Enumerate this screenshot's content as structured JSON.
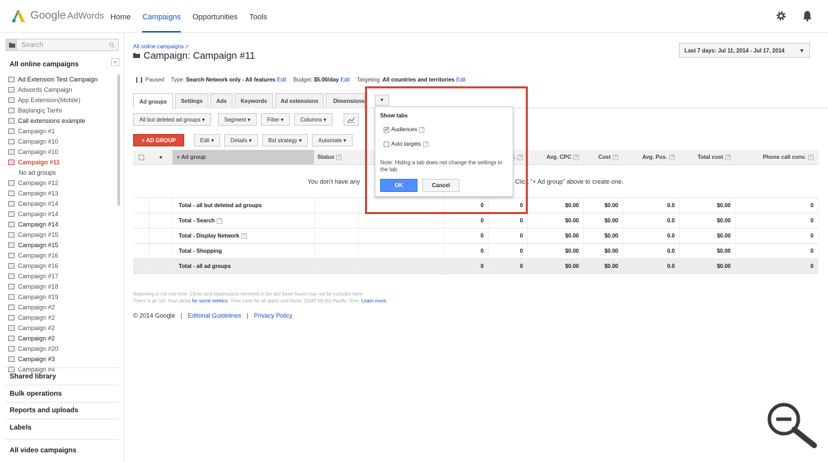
{
  "app": {
    "name": "Google AdWords",
    "name_main": "Google",
    "name_sub": "AdWords"
  },
  "topnav": [
    {
      "label": "Home",
      "active": false
    },
    {
      "label": "Campaigns",
      "active": true
    },
    {
      "label": "Opportunities",
      "active": false
    },
    {
      "label": "Tools",
      "active": false
    }
  ],
  "sidebar": {
    "search_placeholder": "Search",
    "all_campaigns_label": "All online campaigns",
    "campaigns": [
      {
        "label": "Ad Extension Test Campaign",
        "style": "bold"
      },
      {
        "label": "Adwords Campaign",
        "style": ""
      },
      {
        "label": "App Extension(Mobile)",
        "style": ""
      },
      {
        "label": "Başlangıç Tarihi",
        "style": ""
      },
      {
        "label": "Call extensions example",
        "style": "bold"
      },
      {
        "label": "Campaign #1",
        "style": ""
      },
      {
        "label": "Campaign #10",
        "style": ""
      },
      {
        "label": "Campaign #10",
        "style": ""
      },
      {
        "label": "Campaign #11",
        "style": "active"
      },
      {
        "label": "No ad groups",
        "style": "sub"
      },
      {
        "label": "Campaign #12",
        "style": ""
      },
      {
        "label": "Campaign #13",
        "style": ""
      },
      {
        "label": "Campaign #14",
        "style": ""
      },
      {
        "label": "Campaign #14",
        "style": ""
      },
      {
        "label": "Campaign #14",
        "style": "bold"
      },
      {
        "label": "Campaign #15",
        "style": ""
      },
      {
        "label": "Campaign #15",
        "style": "bold"
      },
      {
        "label": "Campaign #16",
        "style": ""
      },
      {
        "label": "Campaign #16",
        "style": ""
      },
      {
        "label": "Campaign #17",
        "style": ""
      },
      {
        "label": "Campaign #18",
        "style": ""
      },
      {
        "label": "Campaign #19",
        "style": ""
      },
      {
        "label": "Campaign #2",
        "style": ""
      },
      {
        "label": "Campaign #2",
        "style": ""
      },
      {
        "label": "Campaign #2",
        "style": ""
      },
      {
        "label": "Campaign #2",
        "style": "bold"
      },
      {
        "label": "Campaign #20",
        "style": ""
      },
      {
        "label": "Campaign #3",
        "style": "bold"
      },
      {
        "label": "Campaign #4",
        "style": ""
      }
    ],
    "sections": [
      "Shared library",
      "Bulk operations",
      "Reports and uploads",
      "Labels",
      "All video campaigns"
    ]
  },
  "main": {
    "breadcrumb": "All online campaigns >",
    "title_prefix": "Campaign:",
    "title": "Campaign #11",
    "date_range": "Last 7 days: Jul 11, 2014 - Jul 17, 2014",
    "info": {
      "status": "Paused",
      "type_label": "Type:",
      "type_value": "Search Network only - All features",
      "budget_label": "Budget:",
      "budget_value": "$5.00/day",
      "targeting_label": "Targeting:",
      "targeting_value": "All countries and territories",
      "edit": "Edit"
    },
    "tabs": [
      "Ad groups",
      "Settings",
      "Ads",
      "Keywords",
      "Ad extensions",
      "Dimensions"
    ],
    "toolbar1": [
      "All but deleted ad groups",
      "Segment",
      "Filter",
      "Columns"
    ],
    "toolbar2": {
      "add_label": "+ AD GROUP",
      "buttons": [
        "Edit",
        "Details",
        "Bid strategy",
        "Automate"
      ]
    },
    "table": {
      "headers": [
        "+ Ad group",
        "Status",
        "Avg. CPC",
        "Cost",
        "Avg. Pos.",
        "Total cost",
        "Phone call conv."
      ],
      "partial_header": "r.",
      "empty_message_left": "You don't have any",
      "empty_message_right": ". Click \"+ Ad group\" above to create one.",
      "totals": [
        {
          "label": "Total - all but deleted ad groups",
          "help": false,
          "c1": "0",
          "c2": "0",
          "cpc": "$0.00",
          "cost": "$0.00",
          "pos": "0.0",
          "total": "$0.00",
          "phone": "0"
        },
        {
          "label": "Total - Search",
          "help": true,
          "c1": "0",
          "c2": "0",
          "cpc": "$0.00",
          "cost": "$0.00",
          "pos": "0.0",
          "total": "$0.00",
          "phone": "0"
        },
        {
          "label": "Total - Display Network",
          "help": true,
          "c1": "0",
          "c2": "0",
          "cpc": "$0.00",
          "cost": "$0.00",
          "pos": "0.0",
          "total": "$0.00",
          "phone": "0"
        },
        {
          "label": "Total - Shopping",
          "help": false,
          "c1": "0",
          "c2": "0",
          "cpc": "$0.00",
          "cost": "$0.00",
          "pos": "0.0",
          "total": "$0.00",
          "phone": "0"
        },
        {
          "label": "Total - all ad groups",
          "help": false,
          "c1": "0",
          "c2": "0",
          "cpc": "$0.00",
          "cost": "$0.00",
          "pos": "0.0",
          "total": "$0.00",
          "phone": "0"
        }
      ]
    },
    "notes": {
      "line1": "Reporting is not real-time. Clicks and impressions received in the last three hours may not be included here.",
      "line2_a": "There is an 18+ hour delay",
      "line2_link": "for some metrics",
      "line2_b": ". Time zone for all dates and times: (GMT-08:00) Pacific Time.",
      "learn_more": "Learn more"
    },
    "footer": {
      "copyright": "© 2014 Google",
      "sep": "|",
      "link1": "Editorial Guidelines",
      "link2": "Privacy Policy"
    }
  },
  "popup": {
    "title": "Show tabs",
    "options": [
      {
        "label": "Audiences",
        "checked": true
      },
      {
        "label": "Auto targets",
        "checked": false
      }
    ],
    "note": "Note: Hiding a tab does not change the settings in the tab.",
    "ok": "OK",
    "cancel": "Cancel"
  },
  "colors": {
    "accent_blue": "#1155cc",
    "red_button": "#dd4b39",
    "highlight_box": "#d9442f",
    "ok_blue": "#4d90fe"
  }
}
